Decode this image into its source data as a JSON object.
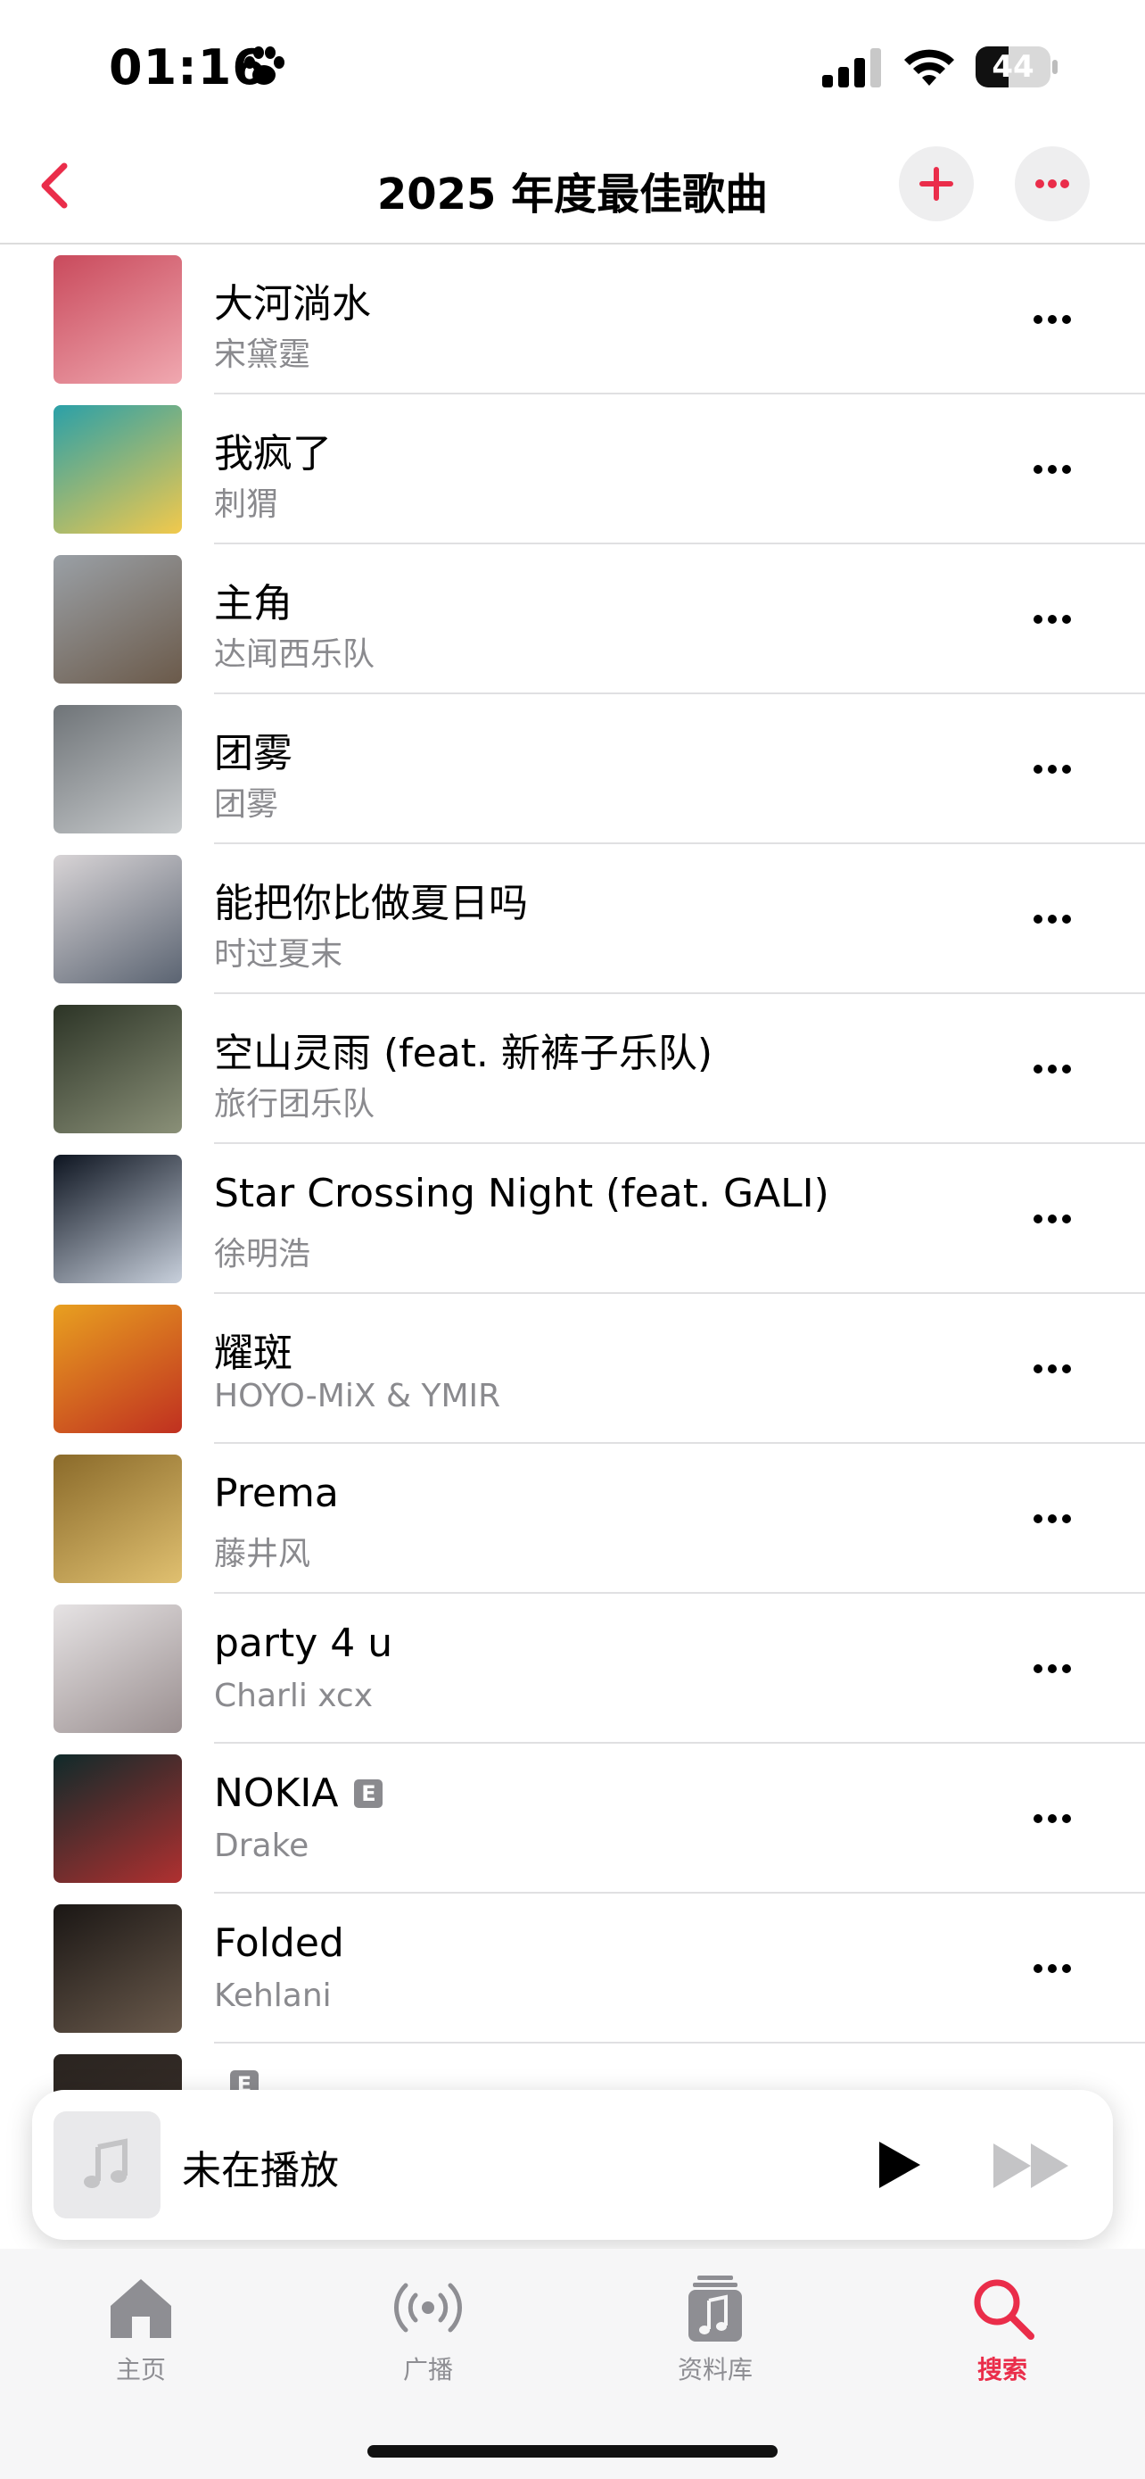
{
  "status_bar": {
    "time": "01:16",
    "battery": "44",
    "battery_level": 0.44
  },
  "nav": {
    "title": "2025 年度最佳歌曲"
  },
  "songs": [
    {
      "title": "大河淌水",
      "artist": "宋黛霆",
      "explicit": false,
      "art_colors": [
        "#c94a5c",
        "#f0a8b0"
      ]
    },
    {
      "title": "我疯了",
      "artist": "刺猬",
      "explicit": false,
      "art_colors": [
        "#2aa0a8",
        "#f2c94c"
      ]
    },
    {
      "title": "主角",
      "artist": "达闻西乐队",
      "explicit": false,
      "art_colors": [
        "#9aa0a6",
        "#6b5a4a"
      ]
    },
    {
      "title": "团雾",
      "artist": "团雾",
      "explicit": false,
      "art_colors": [
        "#6f7478",
        "#c9ccce"
      ]
    },
    {
      "title": "能把你比做夏日吗",
      "artist": "时过夏末",
      "explicit": false,
      "art_colors": [
        "#d8d4d6",
        "#5b6472"
      ]
    },
    {
      "title": "空山灵雨 (feat. 新裤子乐队)",
      "artist": "旅行团乐队",
      "explicit": false,
      "art_colors": [
        "#2c3426",
        "#8a9078"
      ]
    },
    {
      "title": "Star Crossing Night (feat. GALI)",
      "artist": "徐明浩",
      "explicit": false,
      "art_colors": [
        "#0d1420",
        "#c8d0dc"
      ]
    },
    {
      "title": "耀斑",
      "artist": "HOYO-MiX & YMIR",
      "explicit": false,
      "art_colors": [
        "#e8a020",
        "#c03020"
      ]
    },
    {
      "title": "Prema",
      "artist": "藤井风",
      "explicit": false,
      "art_colors": [
        "#8a6a2a",
        "#e0c070"
      ]
    },
    {
      "title": "party 4 u",
      "artist": "Charli xcx",
      "explicit": false,
      "art_colors": [
        "#e6e3e4",
        "#9a8f90"
      ]
    },
    {
      "title": "NOKIA",
      "artist": "Drake",
      "explicit": true,
      "explicit_label": "E",
      "art_colors": [
        "#0f2a2a",
        "#b03030"
      ]
    },
    {
      "title": "Folded",
      "artist": "Kehlani",
      "explicit": false,
      "art_colors": [
        "#1a1614",
        "#6a5a4c"
      ]
    },
    {
      "title": "",
      "artist": "",
      "explicit": true,
      "explicit_label": "E",
      "partial": true,
      "art_colors": [
        "#2a2420",
        "#3a302a"
      ]
    }
  ],
  "mini_player": {
    "title": "未在播放"
  },
  "tabs": [
    {
      "label": "主页",
      "icon": "home-icon",
      "active": false
    },
    {
      "label": "广播",
      "icon": "radio-icon",
      "active": false
    },
    {
      "label": "资料库",
      "icon": "library-icon",
      "active": false
    },
    {
      "label": "搜索",
      "icon": "search-icon",
      "active": true
    }
  ],
  "colors": {
    "accent": "#ea2d4a",
    "secondary_text": "#8a8a8e",
    "inactive_tab": "#8e8e93"
  }
}
